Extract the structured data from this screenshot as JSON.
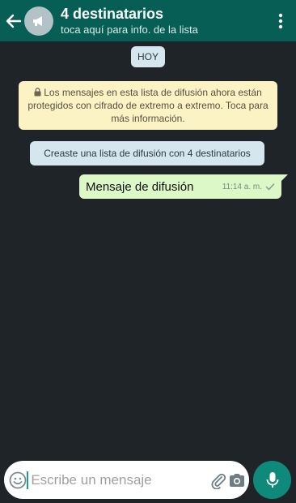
{
  "header": {
    "title": "4 destinatarios",
    "subtitle": "toca aquí para info. de la lista",
    "back_icon": "arrow-left-icon",
    "avatar_icon": "broadcast-megaphone-icon",
    "menu_icon": "more-vert-icon",
    "color": "#075e54"
  },
  "chat": {
    "date_chip": "HOY",
    "encryption_notice": "Los mensajes en esta lista de difusión ahora están protegidos con cifrado de extremo a extremo. Toca para más información.",
    "created_notice": "Creaste una lista de difusión con 4 destinatarios",
    "messages": [
      {
        "text": "Mensaje de difusión",
        "time": "11:14 a. m.",
        "status": "sent"
      }
    ],
    "background": "#1e2428",
    "bubble_color": "#dcf8c6",
    "notice_color": "#fcf3c5"
  },
  "composer": {
    "placeholder": "Escribe un mensaje",
    "emoji_icon": "emoji-icon",
    "attach_icon": "paperclip-icon",
    "camera_icon": "camera-icon",
    "mic_icon": "mic-icon",
    "accent": "#0f8a7a"
  }
}
